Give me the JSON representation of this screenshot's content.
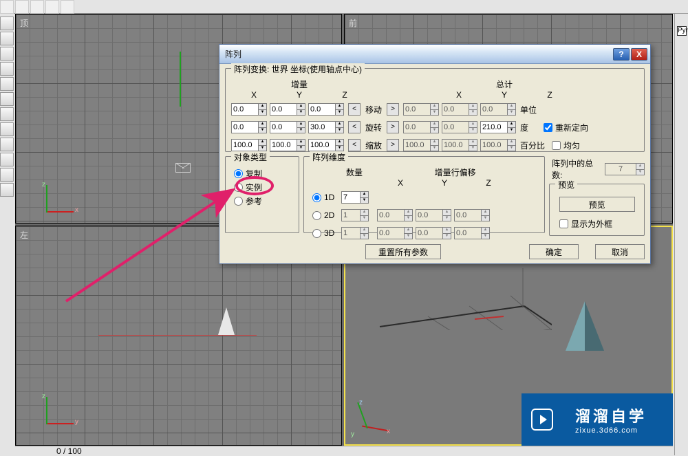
{
  "viewports": {
    "top_left_label": "顶",
    "top_right_label": "前",
    "bot_left_label": "左",
    "bot_right_label": ""
  },
  "statusbar": {
    "text": "0 / 100"
  },
  "right_hint": "Pyr",
  "dialog": {
    "title": "阵列",
    "help_label": "?",
    "close_label": "X",
    "transform_legend": "阵列变换: 世界 坐标(使用轴点中心)",
    "incremental_label": "增量",
    "total_label": "总计",
    "axis_x": "X",
    "axis_y": "Y",
    "axis_z": "Z",
    "move_label": "移动",
    "rotate_label": "旋转",
    "scale_label": "缩放",
    "units_label": "单位",
    "degrees_label": "度",
    "percent_label": "百分比",
    "reorient_label": "重新定向",
    "uniform_label": "均匀",
    "move": {
      "ix": "0.0",
      "iy": "0.0",
      "iz": "0.0",
      "tx": "0.0",
      "ty": "0.0",
      "tz": "0.0"
    },
    "rotate": {
      "ix": "0.0",
      "iy": "0.0",
      "iz": "30.0",
      "tx": "0.0",
      "ty": "0.0",
      "tz": "210.0"
    },
    "scale": {
      "ix": "100.0",
      "iy": "100.0",
      "iz": "100.0",
      "tx": "100.0",
      "ty": "100.0",
      "tz": "100.0"
    },
    "arrow_left": "<",
    "arrow_right": ">",
    "object_type_legend": "对象类型",
    "obj_copy": "复制",
    "obj_instance": "实例",
    "obj_reference": "参考",
    "dims_legend": "阵列维度",
    "count_label": "数量",
    "row_offset_label": "增量行偏移",
    "dim_1d": "1D",
    "dim_2d": "2D",
    "dim_3d": "3D",
    "dim1_count": "7",
    "dim2_count": "1",
    "dim3_count": "1",
    "dim2": {
      "x": "0.0",
      "y": "0.0",
      "z": "0.0"
    },
    "dim3": {
      "x": "0.0",
      "y": "0.0",
      "z": "0.0"
    },
    "total_legend": "阵列中的总数:",
    "total_count": "7",
    "preview_legend": "预览",
    "preview_btn": "预览",
    "display_wire_label": "显示为外框",
    "reset_btn": "重置所有参数",
    "ok_btn": "确定",
    "cancel_btn": "取消"
  },
  "watermark": {
    "main": "溜溜自学",
    "sub": "zixue.3d66.com"
  }
}
